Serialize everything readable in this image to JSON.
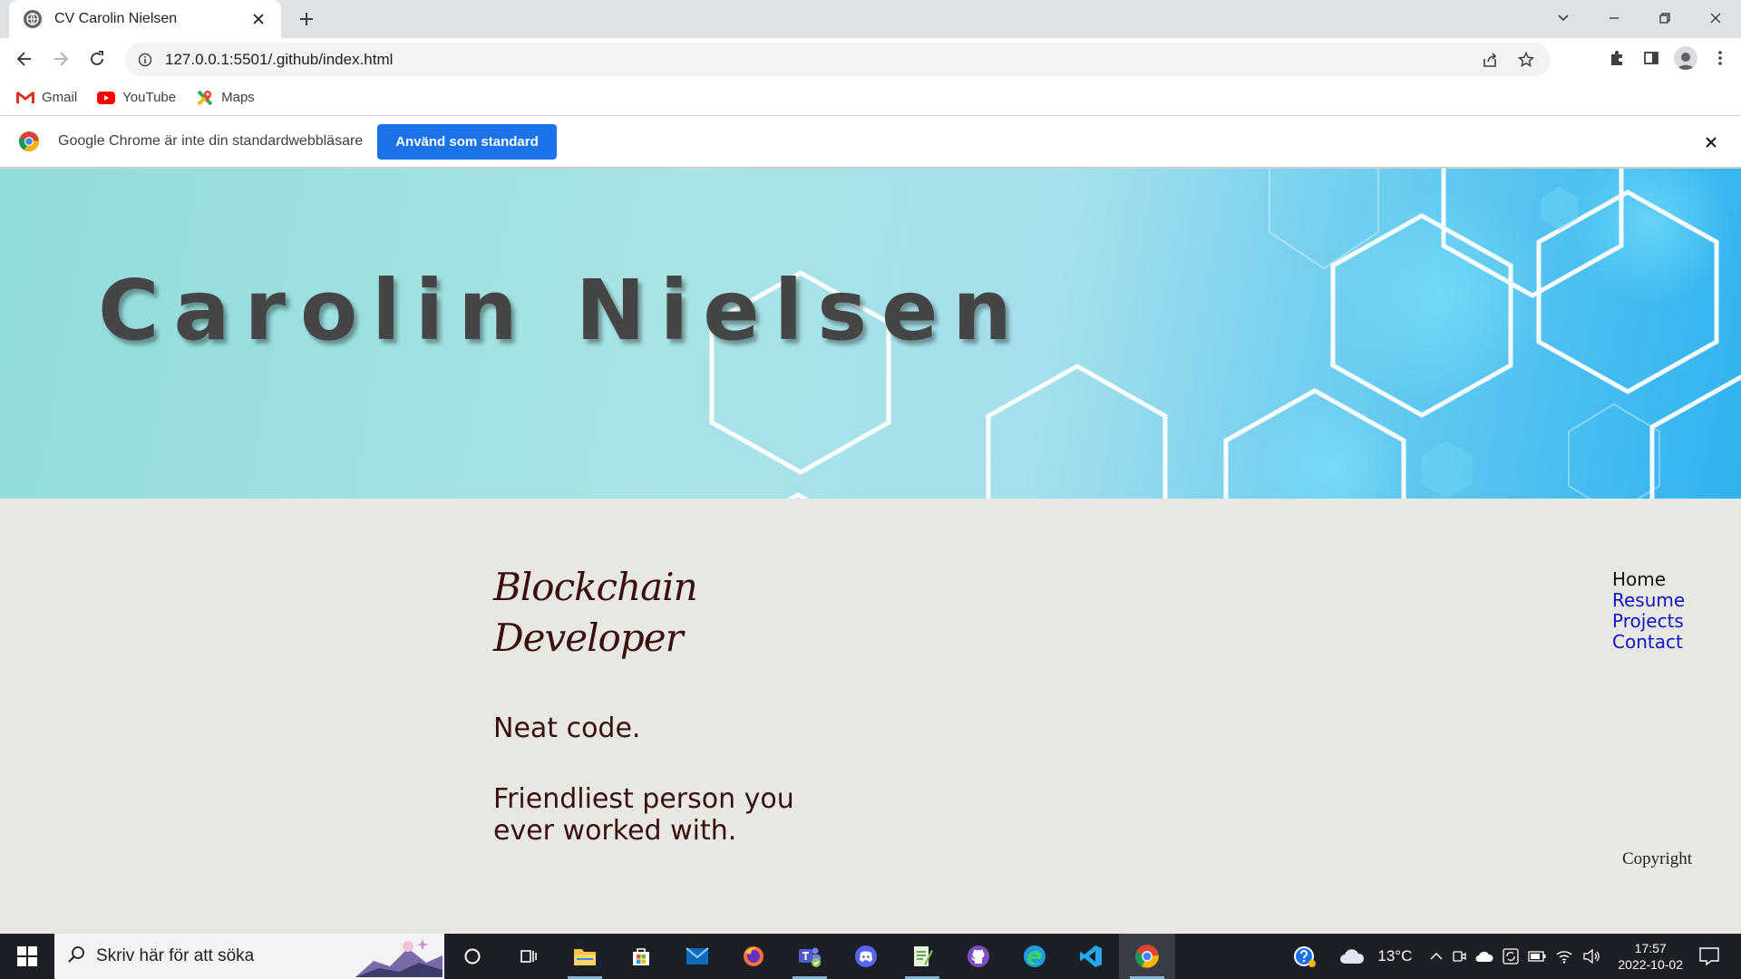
{
  "browser": {
    "tab_title": "CV Carolin Nielsen",
    "url": "127.0.0.1:5501/.github/index.html",
    "bookmarks": [
      {
        "label": "Gmail",
        "icon": "gmail-icon"
      },
      {
        "label": "YouTube",
        "icon": "youtube-icon"
      },
      {
        "label": "Maps",
        "icon": "maps-icon"
      }
    ],
    "infobar": {
      "message": "Google Chrome är inte din standardwebbläsare",
      "button_label": "Använd som standard"
    }
  },
  "page": {
    "name": "Carolin Nielsen",
    "role_line1": "Blockchain",
    "role_line2": "Developer",
    "tagline1": "Neat code.",
    "tagline2": "Friendliest person you ever worked with.",
    "nav": [
      {
        "label": "Home",
        "current": true
      },
      {
        "label": "Resume",
        "current": false
      },
      {
        "label": "Projects",
        "current": false
      },
      {
        "label": "Contact",
        "current": false
      }
    ],
    "copyright": "Copyright"
  },
  "taskbar": {
    "search_placeholder": "Skriv här för att söka",
    "temperature": "13°C",
    "time": "17:57",
    "date": "2022-10-02"
  },
  "colors": {
    "accent_blue": "#1a73e8",
    "link_blue": "#1313c8",
    "heading_maroon": "#3a0f0f",
    "content_bg": "#e8e8e3"
  }
}
